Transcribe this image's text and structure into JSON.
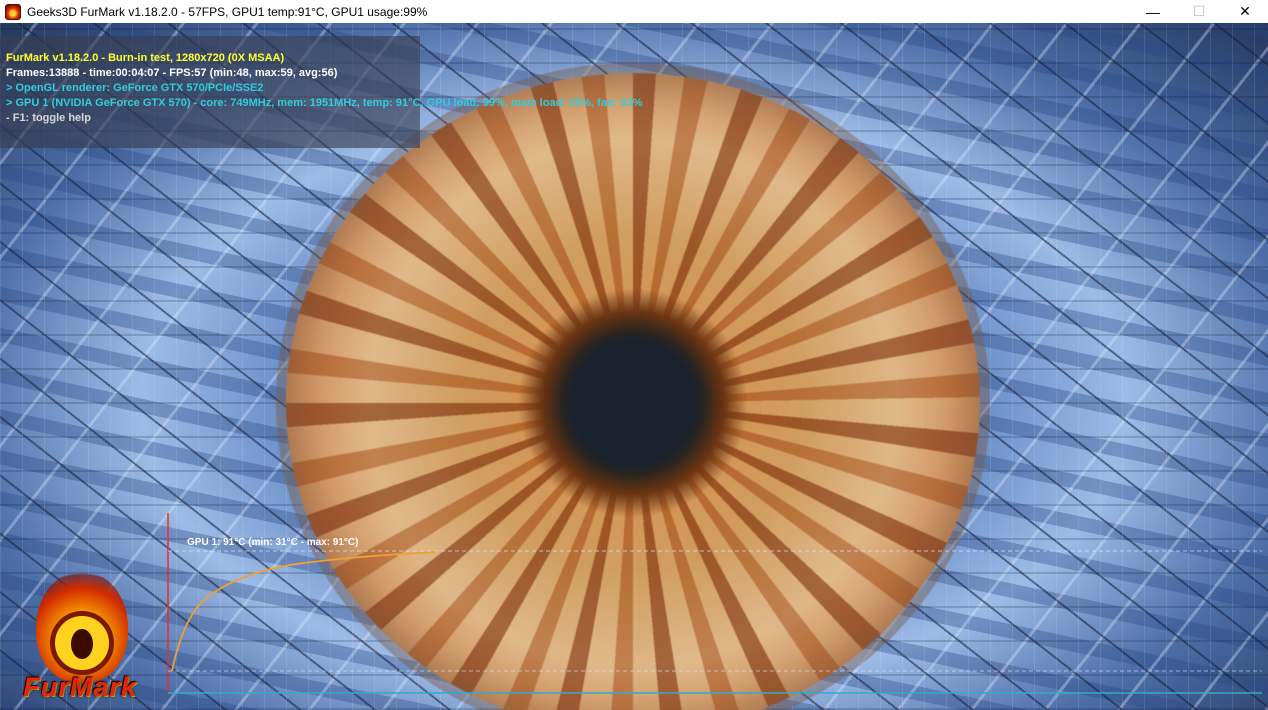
{
  "window": {
    "title": "Geeks3D FurMark v1.18.2.0 - 57FPS, GPU1 temp:91°C, GPU1 usage:99%",
    "controls": {
      "minimize": "—",
      "maximize": "☐",
      "close": "✕"
    }
  },
  "overlay": {
    "line1": "FurMark v1.18.2.0 - Burn-in test, 1280x720 (0X MSAA)",
    "line2": "Frames:13888 - time:00:04:07 - FPS:57 (min:48, max:59, avg:56)",
    "line3": "> OpenGL renderer: GeForce GTX 570/PCIe/SSE2",
    "line4": "> GPU 1 (NVIDIA GeForce GTX 570) - core: 749MHz, mem: 1951MHz, temp: 91°C, GPU load: 99%, mem load: 29%, fan: 93%",
    "line5": "- F1: toggle help"
  },
  "graph": {
    "label": "GPU 1: 91°C (min: 31°C - max: 91°C)",
    "curve_color": "#f0a030",
    "axis_color": "#e03030",
    "baseline_color": "#33aacc",
    "temperature": {
      "min": 31,
      "max": 91,
      "current": 91
    }
  },
  "logo": {
    "text": "FurMark"
  },
  "colors": {
    "title_yellow": "#ffff33",
    "info_cyan": "#33ccdd"
  }
}
